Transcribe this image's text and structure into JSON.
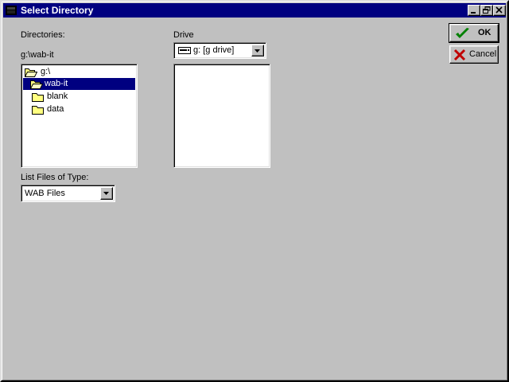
{
  "window": {
    "title": "Select Directory"
  },
  "labels": {
    "directories": "Directories:",
    "current_path": "g:\\wab-it",
    "drive": "Drive",
    "list_files_of_type": "List Files of Type:"
  },
  "directories": [
    {
      "name": "g:\\",
      "icon": "folder-open-icon",
      "level": 0,
      "selected": false
    },
    {
      "name": "wab-it",
      "icon": "folder-open-icon",
      "level": 1,
      "selected": true
    },
    {
      "name": "blank",
      "icon": "folder-icon",
      "level": 2,
      "selected": false
    },
    {
      "name": "data",
      "icon": "folder-icon",
      "level": 2,
      "selected": false
    }
  ],
  "drive_select": {
    "selected": "g: [g drive]",
    "icon": "drive-icon"
  },
  "file_type_select": {
    "selected": "WAB Files"
  },
  "buttons": {
    "ok_label": "OK",
    "cancel_label": "Cancel"
  },
  "colors": {
    "title_bar": "#000080",
    "selection": "#000080",
    "face": "#c0c0c0",
    "ok_check": "#008000",
    "cancel_x": "#c00000"
  }
}
